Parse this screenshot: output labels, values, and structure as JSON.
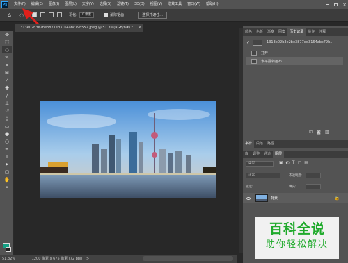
{
  "app": {
    "logo": "Ps"
  },
  "menus": [
    "文件(F)",
    "编辑(E)",
    "图像(I)",
    "图层(L)",
    "文字(Y)",
    "选择(S)",
    "滤镜(T)",
    "3D(D)",
    "视图(V)",
    "增效工具",
    "窗口(W)",
    "帮助(H)"
  ],
  "options": {
    "feather_label": "羽化:",
    "feather_value": "0 像素",
    "antialias_label": "消除锯齿",
    "select_mask": "选择并遮住..."
  },
  "document": {
    "tab_title": "1313e02b3e2be3877ed3164abc79b552.jpeg @ 51.3%(RGB/8#) *",
    "close": "×"
  },
  "status": {
    "zoom": "51.32%",
    "info": "1200 像素 x 675 像素 (72 ppi)",
    "arrow": ">"
  },
  "panel_top": {
    "tabs": [
      "颜色",
      "色板",
      "渐变",
      "图案",
      "历史记录",
      "操作",
      "注释"
    ],
    "active": "历史记录"
  },
  "history": {
    "snapshot": "1313e02b3e2be3877ed3164abc79b...",
    "items": [
      "打开",
      "水平翻转画布"
    ]
  },
  "panel_bottom": {
    "tabs": [
      "字符",
      "段落",
      "路径"
    ],
    "subtabs": [
      "库",
      "调整",
      "通道",
      "图层"
    ],
    "active": "图层"
  },
  "layers": {
    "kind": "类型",
    "blend": "正常",
    "opacity_label": "不透明度:",
    "lock_label": "锁定:",
    "fill_label": "填充:",
    "layer_name": "背景"
  },
  "tools": [
    "move-icon",
    "marquee-icon",
    "lasso-icon",
    "quick-select-icon",
    "crop-icon",
    "frame-icon",
    "eyedropper-icon",
    "healing-icon",
    "brush-icon",
    "stamp-icon",
    "history-brush-icon",
    "eraser-icon",
    "gradient-icon",
    "blur-icon",
    "dodge-icon",
    "pen-icon",
    "type-icon",
    "path-select-icon",
    "shape-icon",
    "hand-icon",
    "zoom-icon",
    "more-icon"
  ],
  "colors": {
    "foreground": "#14a084",
    "background": "#222222",
    "accent": "#31a8ff",
    "arrow": "#e0201b",
    "watermark": "#1faa2b"
  },
  "watermark": {
    "title": "百科全说",
    "subtitle": "助你轻松解决"
  }
}
